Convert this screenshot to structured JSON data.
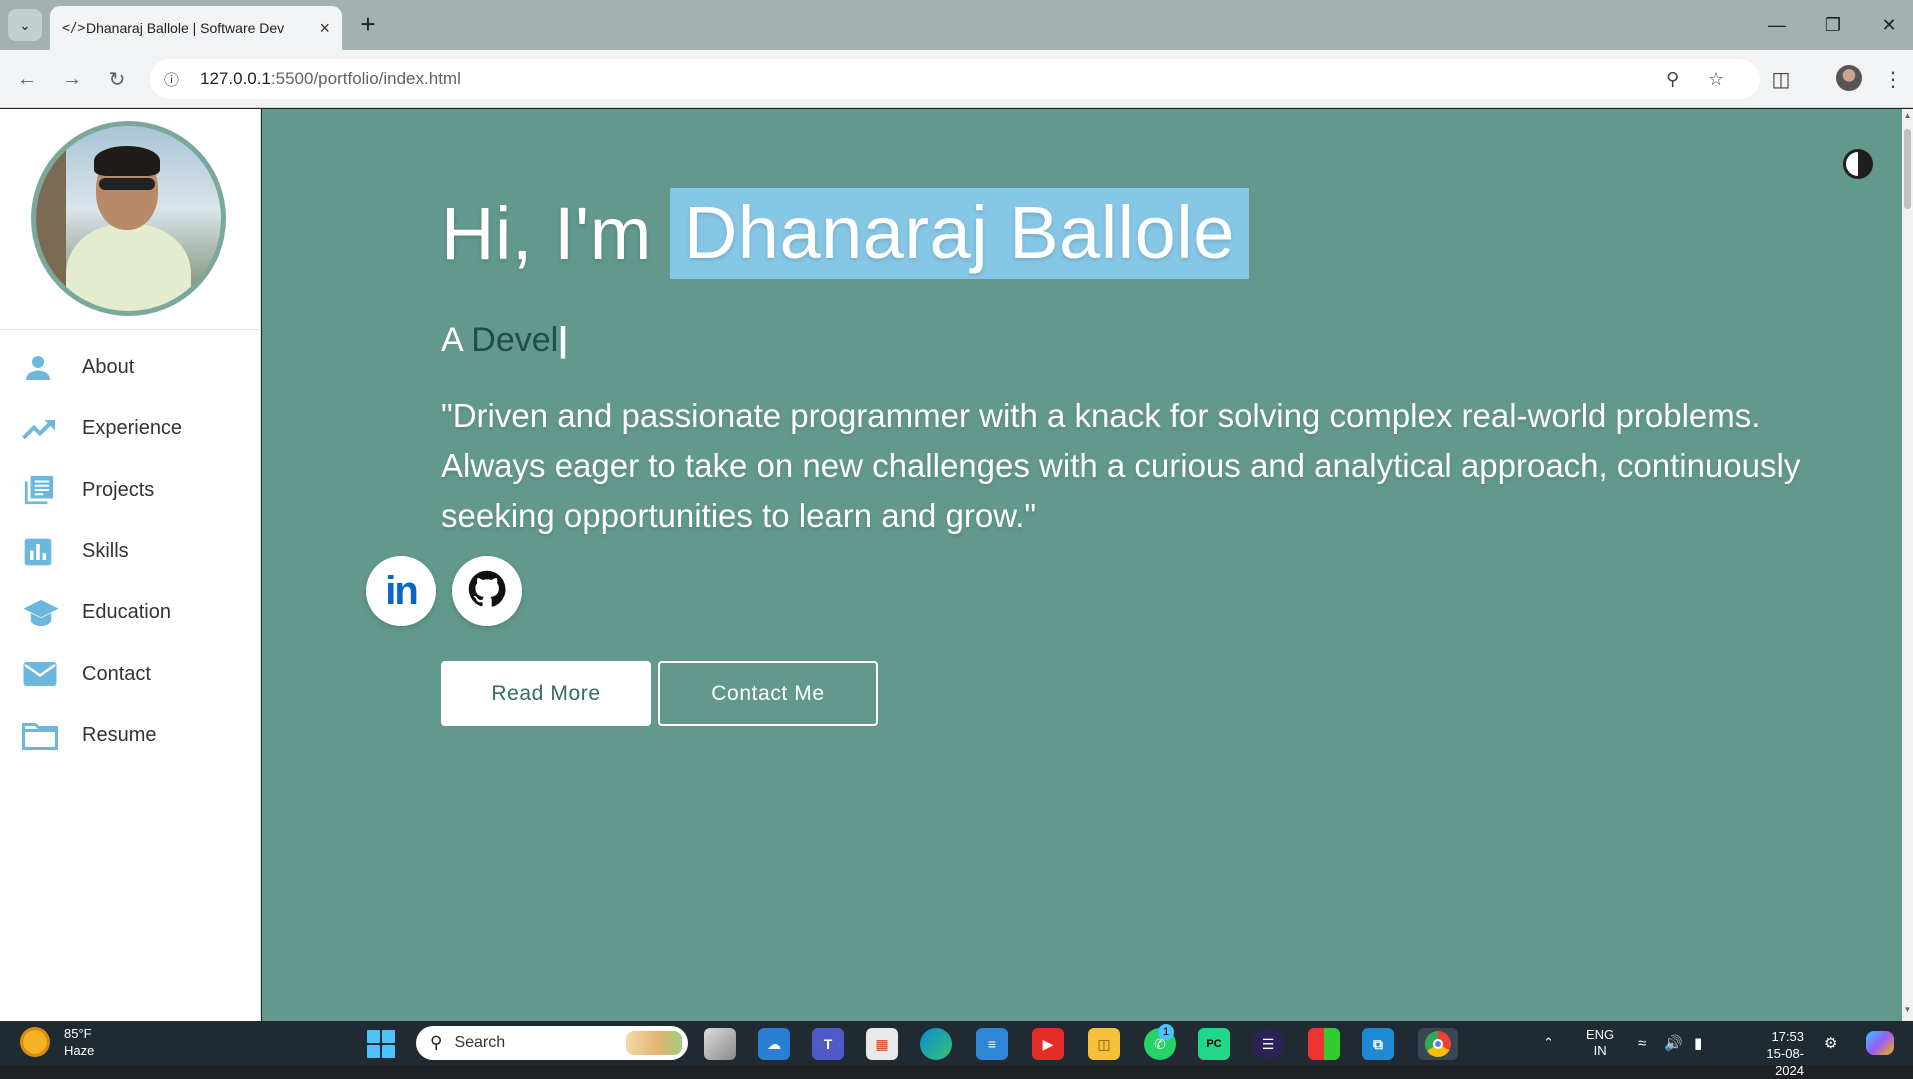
{
  "browser": {
    "tab_title": "Dhanaraj Ballole | Software Dev",
    "tab_favicon": "</>",
    "url_host": "127.0.0.1",
    "url_rest": ":5500/portfolio/index.html"
  },
  "sidebar": {
    "items": [
      {
        "label": "About",
        "icon": "person-icon"
      },
      {
        "label": "Experience",
        "icon": "trending-up-icon"
      },
      {
        "label": "Projects",
        "icon": "library-books-icon"
      },
      {
        "label": "Skills",
        "icon": "bar-chart-icon"
      },
      {
        "label": "Education",
        "icon": "graduation-cap-icon"
      },
      {
        "label": "Contact",
        "icon": "mail-icon"
      },
      {
        "label": "Resume",
        "icon": "folder-icon"
      }
    ]
  },
  "hero": {
    "greeting": "Hi, I'm",
    "name": "Dhanaraj Ballole",
    "role_prefix": "A",
    "role_typed": "Devel",
    "quote": "\"Driven and passionate programmer with a knack for solving complex real-world problems. Always eager to take on new challenges with a curious and analytical approach, continuously seeking opportunities to learn and grow.\"",
    "read_more": "Read More",
    "contact_me": "Contact Me"
  },
  "taskbar": {
    "weather_temp": "85°F",
    "weather_desc": "Haze",
    "search_label": "Search",
    "whatsapp_badge": "1",
    "lang_top": "ENG",
    "lang_bottom": "IN",
    "time": "17:53",
    "date": "15-08-2024"
  },
  "colors": {
    "main_bg": "#62998c",
    "name_highlight": "#87c7e6",
    "nav_icon": "#6cb8dc",
    "typed_text": "#1f4f44"
  }
}
